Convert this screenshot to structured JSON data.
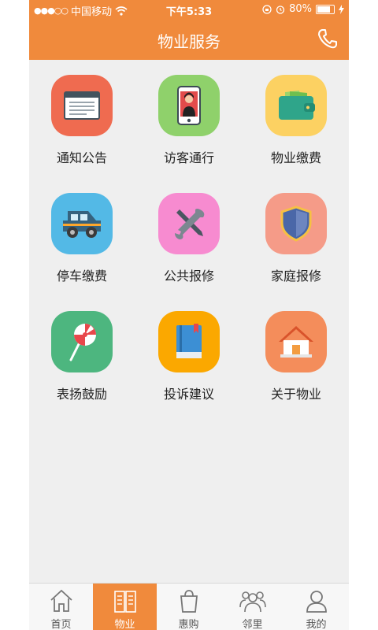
{
  "status_bar": {
    "carrier": "中国移动",
    "time": "下午5:33",
    "battery": "80%"
  },
  "header": {
    "title": "物业服务"
  },
  "icons": {
    "phone": "phone-icon",
    "notice": "window-icon",
    "visitor": "smartphone-person-icon",
    "fee": "wallet-icon",
    "parking": "car-icon",
    "public_repair": "wrench-screwdriver-icon",
    "home_repair": "shield-icon",
    "praise": "lollipop-icon",
    "complaint": "book-icon",
    "about": "house-icon"
  },
  "services": [
    {
      "label": "通知公告",
      "color": "#ef6b50"
    },
    {
      "label": "访客通行",
      "color": "#8fd16b"
    },
    {
      "label": "物业缴费",
      "color": "#fcd162"
    },
    {
      "label": "停车缴费",
      "color": "#53b9e6"
    },
    {
      "label": "公共报修",
      "color": "#f78bd0"
    },
    {
      "label": "家庭报修",
      "color": "#f59b88"
    },
    {
      "label": "表扬鼓励",
      "color": "#4db67f"
    },
    {
      "label": "投诉建议",
      "color": "#fba800"
    },
    {
      "label": "关于物业",
      "color": "#f48d5b"
    }
  ],
  "tabs": [
    {
      "label": "首页"
    },
    {
      "label": "物业"
    },
    {
      "label": "惠购"
    },
    {
      "label": "邻里"
    },
    {
      "label": "我的"
    }
  ],
  "colors": {
    "brand": "#f08a3c",
    "background": "#efefef"
  }
}
